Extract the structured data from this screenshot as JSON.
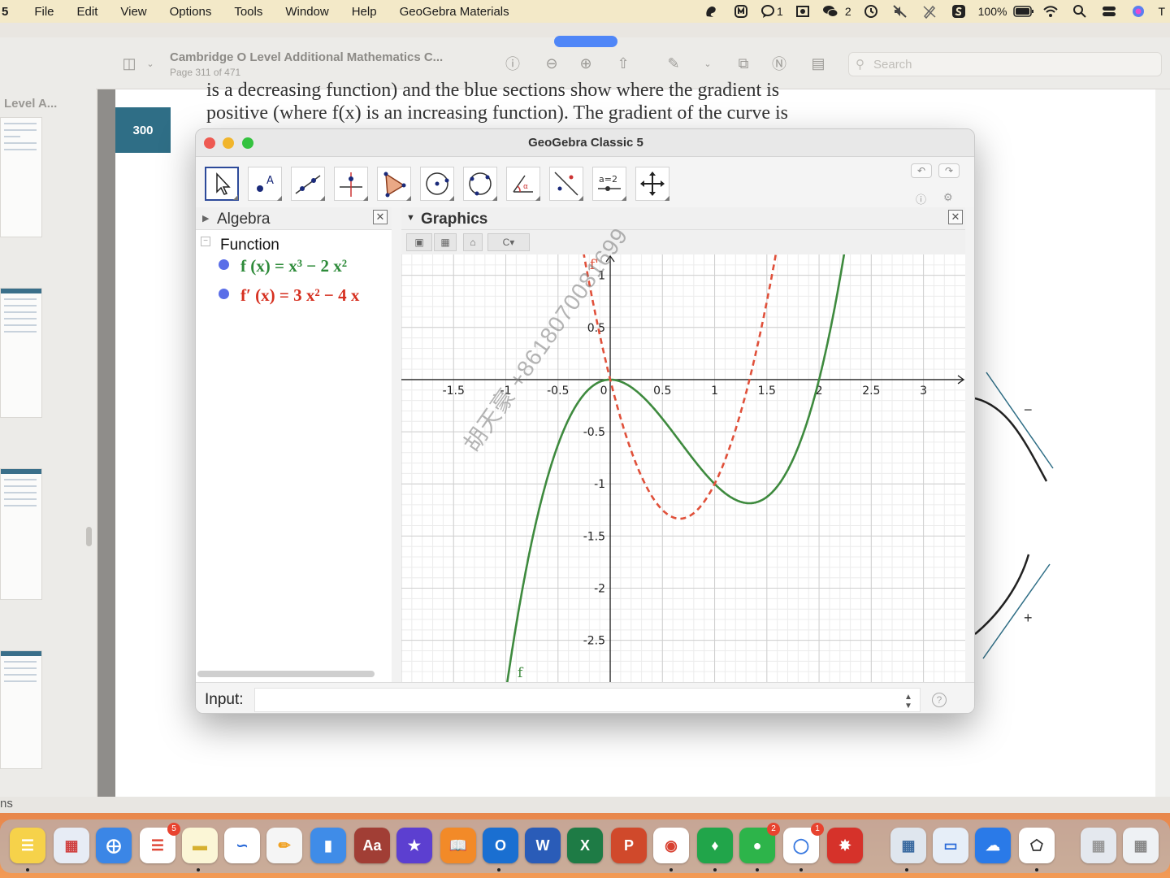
{
  "menubar": {
    "items": [
      "5",
      "File",
      "Edit",
      "View",
      "Options",
      "Tools",
      "Window",
      "Help",
      "GeoGebra Materials"
    ],
    "wechat_count": "2",
    "chat_count": "1",
    "battery": "100%",
    "clock": "T"
  },
  "preview": {
    "doc_title": "Cambridge  O Level Additional Mathematics C...",
    "page_info": "Page 311 of 471",
    "search_placeholder": "Search"
  },
  "sidebar": {
    "title": "Level A...",
    "bottom_label": "ns"
  },
  "document": {
    "page_number": "300",
    "line1": "is a decreasing function) and the blue sections show where the gradient is",
    "line2": "positive (where f(x) is an increasing function). The gradient of the curve is",
    "sign_minus": "−",
    "sign_plus": "+"
  },
  "geogebra": {
    "window_title": "GeoGebra Classic 5",
    "algebra_title": "Algebra",
    "graphics_title": "Graphics",
    "group_label": "Function",
    "f_expr": "f (x)  =  x³ − 2 x²",
    "fp_expr": "f′ (x)  =  3 x² − 4 x",
    "input_label": "Input:",
    "tool_label_a2": "a=2"
  },
  "chart_data": {
    "type": "line",
    "xlim": [
      -2.0,
      3.4
    ],
    "ylim": [
      -2.9,
      1.2
    ],
    "x_ticks": [
      -1.5,
      -1,
      -0.5,
      0,
      0.5,
      1,
      1.5,
      2,
      2.5,
      3
    ],
    "x_tick_labels": [
      "-1.5",
      "-1",
      "-0.5",
      "0",
      "0.5",
      "1",
      "1.5",
      "2",
      "2.5",
      "3"
    ],
    "y_ticks": [
      0.5,
      1,
      -0.5,
      -1,
      -1.5,
      -2,
      -2.5
    ],
    "y_tick_labels": [
      "0.5",
      "1",
      "-0.5",
      "-1",
      "-1.5",
      "-2",
      "-2.5"
    ],
    "grid": true,
    "series": [
      {
        "name": "f",
        "formula": "x^3 - 2x^2",
        "color": "#3e8a3e",
        "style": "solid",
        "x": [
          -1,
          -0.5,
          0,
          0.5,
          1,
          1.33,
          1.5,
          2,
          2.25
        ],
        "y": [
          -3,
          -0.625,
          0,
          -0.375,
          -1,
          -1.185,
          -1.125,
          0,
          1.27
        ]
      },
      {
        "name": "f'",
        "formula": "3x^2 - 4x",
        "color": "#e0503a",
        "style": "dashed",
        "x": [
          -0.25,
          0,
          0.5,
          0.67,
          1,
          1.5,
          1.58
        ],
        "y": [
          1.19,
          0,
          -1.25,
          -1.333,
          -1,
          0.75,
          1.17
        ]
      }
    ],
    "curve_labels": [
      "f",
      "f'"
    ]
  },
  "dock": {
    "notes_badge": "5",
    "wechat_badge": "2",
    "chat_badge": "1"
  }
}
